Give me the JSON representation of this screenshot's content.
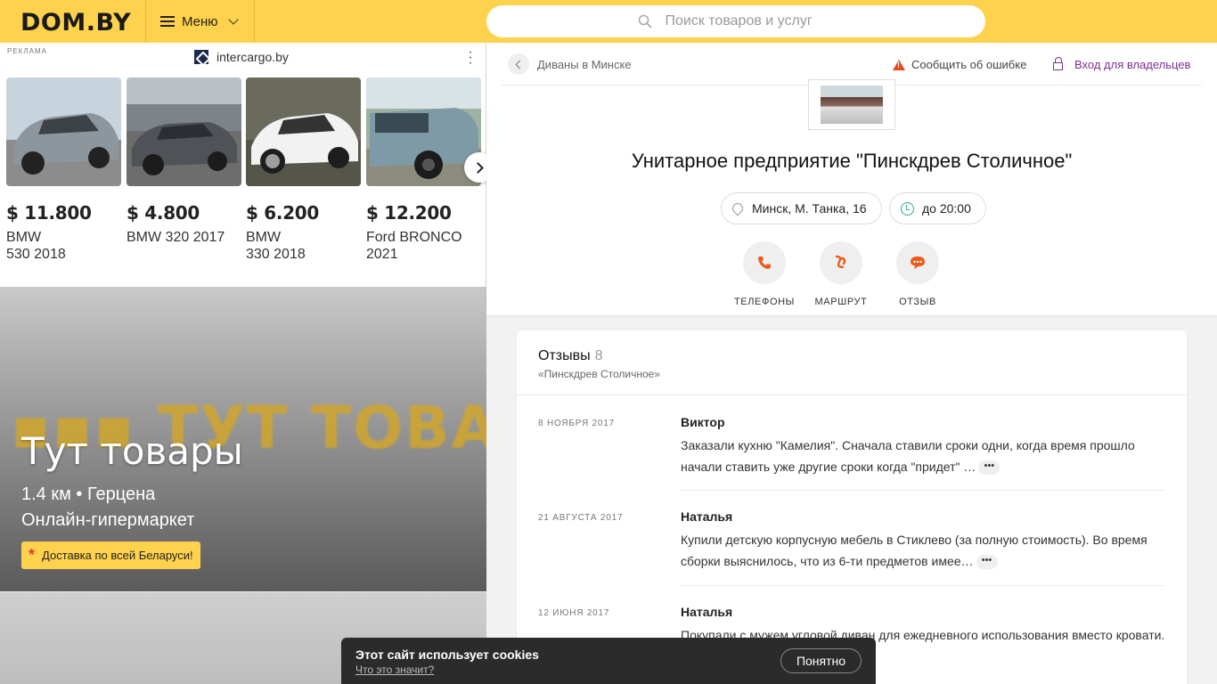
{
  "header": {
    "logo": "DOM.BY",
    "menu_label": "Меню",
    "search_placeholder": "Поиск товаров и услуг"
  },
  "ad": {
    "label": "РЕКЛАМА",
    "source": "intercargo.by",
    "cars": [
      {
        "price": "$ 11.800",
        "name_line1": "BMW",
        "name_line2": "530 2018",
        "color": "#8e969d"
      },
      {
        "price": "$ 4.800",
        "name_line1": "BMW 320 2017",
        "name_line2": "",
        "color": "#4f5357"
      },
      {
        "price": "$ 6.200",
        "name_line1": "BMW",
        "name_line2": "330 2018",
        "color": "#f2f2f2"
      },
      {
        "price": "$ 12.200",
        "name_line1": "Ford BRONCO",
        "name_line2": "2021",
        "color": "#7e9aa6"
      }
    ]
  },
  "promo": {
    "bg_text": "▪▪▪ ТУТ ТОВАРЫ",
    "title": "Тут товары",
    "distance": "1.4 км • Герцена",
    "subtitle": "Онлайн-гипермаркет",
    "badge": "Доставка по всей Беларуси!"
  },
  "card": {
    "breadcrumb": "Диваны в Минске",
    "report": "Сообщить об ошибке",
    "owner_login": "Вход для владельцев",
    "company_name": "Унитарное предприятие \"Пинскдрев Столичное\"",
    "address": "Минск, М. Танка, 16",
    "hours": "до 20:00",
    "actions": {
      "phones": "ТЕЛЕФОНЫ",
      "route": "МАРШРУТ",
      "review": "ОТЗЫВ"
    }
  },
  "reviews": {
    "title": "Отзывы",
    "count": "8",
    "subtitle": "«Пинскдрев Столичное»",
    "items": [
      {
        "date": "8 НОЯБРЯ 2017",
        "author": "Виктор",
        "text": "Заказали кухню \"Камелия\". Сначала ставили сроки одни, когда время прошло начали ставить уже другие сроки когда \"придет\" …"
      },
      {
        "date": "21 АВГУСТА 2017",
        "author": "Наталья",
        "text": "Купили детскую корпусную мебель в Стиклево (за полную стоимость). Во время сборки выяснилось, что из 6-ти предметов имее…"
      },
      {
        "date": "12 ИЮНЯ 2017",
        "author": "Наталья",
        "text": "Покупали с мужем угловой диван для ежедневного использования вместо кровати. Нас заверили, что дива…"
      }
    ],
    "more_label": "•••"
  },
  "cookie": {
    "title": "Этот сайт использует cookies",
    "link": "Что это значит?",
    "button": "Понятно"
  },
  "colors": {
    "accent_yellow": "#ffd24d",
    "action_orange": "#ef5a1a",
    "owner_purple": "#7b2f8f",
    "clock_green": "#2eaf7d"
  }
}
